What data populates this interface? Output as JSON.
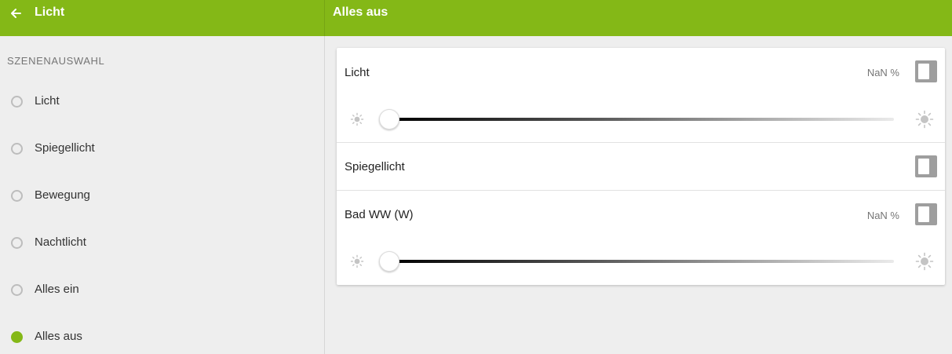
{
  "header": {
    "app_title": "Licht",
    "panel_title": "Alles aus"
  },
  "sidebar": {
    "section_label": "SZENENAUSWAHL",
    "scenes": [
      {
        "label": "Licht",
        "selected": false
      },
      {
        "label": "Spiegellicht",
        "selected": false
      },
      {
        "label": "Bewegung",
        "selected": false
      },
      {
        "label": "Nachtlicht",
        "selected": false
      },
      {
        "label": "Alles ein",
        "selected": false
      },
      {
        "label": "Alles aus",
        "selected": true
      }
    ]
  },
  "devices": [
    {
      "label": "Licht",
      "value": "NaN %",
      "on": false,
      "dimmer_level": 0
    },
    {
      "label": "Spiegellicht",
      "on": false
    },
    {
      "label": "Bad WW (W)",
      "value": "NaN %",
      "on": false,
      "dimmer_level": 0
    }
  ],
  "colors": {
    "accent": "#84b817",
    "toggle_off": "#9e9e9e"
  },
  "icons": {
    "back": "arrow-left-icon",
    "dim_low": "sun-small-icon",
    "dim_high": "sun-large-icon"
  }
}
